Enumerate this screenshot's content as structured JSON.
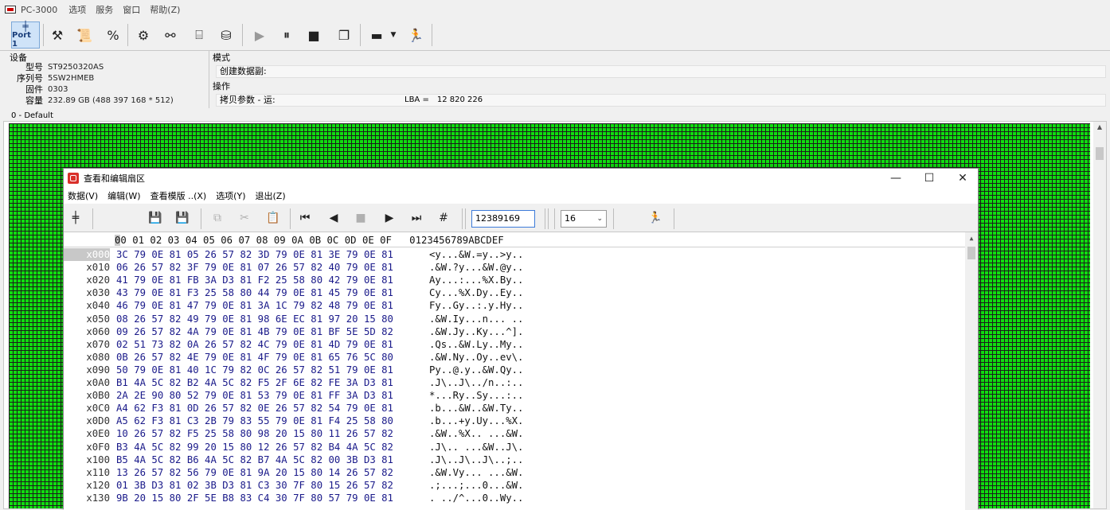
{
  "app": {
    "title": "PC-3000",
    "menu": [
      "选项",
      "服务",
      "窗口",
      "帮助(Z)"
    ]
  },
  "toolbar": {
    "port_label": "Port 1"
  },
  "device": {
    "section_title": "设备",
    "fields": [
      {
        "label": "型号",
        "value": "ST9250320AS"
      },
      {
        "label": "序列号",
        "value": "5SW2HMEB"
      },
      {
        "label": "固件",
        "value": "0303"
      },
      {
        "label": "容量",
        "value": "232.89 GB (488 397 168 * 512)"
      }
    ]
  },
  "mode": {
    "title": "模式",
    "field": "创建数据副:"
  },
  "operation": {
    "title": "操作",
    "field": "拷贝参数 - 运:",
    "lba_label": "LBA =",
    "lba_value": "12 820 226"
  },
  "tab": {
    "label": "0 - Default"
  },
  "sector_window": {
    "title": "查看和编辑扇区",
    "menu": [
      "数据(V)",
      "编辑(W)",
      "查看模版 ..(X)",
      "选项(Y)",
      "退出(Z)"
    ],
    "lba_input": "12389169",
    "size_select": "16",
    "hex_header_first": "0",
    "hex_header_rest": "0 01 02 03 04 05 06 07 08 09 0A 0B 0C 0D 0E 0F   0123456789ABCDEF",
    "rows": [
      {
        "addr": "x000",
        "bytes": "3C 79 0E 81 05 26 57 82 3D 79 0E 81 3E 79 0E 81",
        "ascii": "<y...&W.=y..>y.."
      },
      {
        "addr": "x010",
        "bytes": "06 26 57 82 3F 79 0E 81 07 26 57 82 40 79 0E 81",
        "ascii": ".&W.?y...&W.@y.."
      },
      {
        "addr": "x020",
        "bytes": "41 79 0E 81 FB 3A D3 81 F2 25 58 80 42 79 0E 81",
        "ascii": "Ay...:...%X.By.."
      },
      {
        "addr": "x030",
        "bytes": "43 79 0E 81 F3 25 58 80 44 79 0E 81 45 79 0E 81",
        "ascii": "Cy...%X.Dy..Ey.."
      },
      {
        "addr": "x040",
        "bytes": "46 79 0E 81 47 79 0E 81 3A 1C 79 82 48 79 0E 81",
        "ascii": "Fy..Gy..:.y.Hy.."
      },
      {
        "addr": "x050",
        "bytes": "08 26 57 82 49 79 0E 81 98 6E EC 81 97 20 15 80",
        "ascii": ".&W.Iy...n... .."
      },
      {
        "addr": "x060",
        "bytes": "09 26 57 82 4A 79 0E 81 4B 79 0E 81 BF 5E 5D 82",
        "ascii": ".&W.Jy..Ky...^]."
      },
      {
        "addr": "x070",
        "bytes": "02 51 73 82 0A 26 57 82 4C 79 0E 81 4D 79 0E 81",
        "ascii": ".Qs..&W.Ly..My.."
      },
      {
        "addr": "x080",
        "bytes": "0B 26 57 82 4E 79 0E 81 4F 79 0E 81 65 76 5C 80",
        "ascii": ".&W.Ny..Oy..ev\\."
      },
      {
        "addr": "x090",
        "bytes": "50 79 0E 81 40 1C 79 82 0C 26 57 82 51 79 0E 81",
        "ascii": "Py..@.y..&W.Qy.."
      },
      {
        "addr": "x0A0",
        "bytes": "B1 4A 5C 82 B2 4A 5C 82 F5 2F 6E 82 FE 3A D3 81",
        "ascii": ".J\\..J\\../n..:.."
      },
      {
        "addr": "x0B0",
        "bytes": "2A 2E 90 80 52 79 0E 81 53 79 0E 81 FF 3A D3 81",
        "ascii": "*...Ry..Sy...:.."
      },
      {
        "addr": "x0C0",
        "bytes": "A4 62 F3 81 0D 26 57 82 0E 26 57 82 54 79 0E 81",
        "ascii": ".b...&W..&W.Ty.."
      },
      {
        "addr": "x0D0",
        "bytes": "A5 62 F3 81 C3 2B 79 83 55 79 0E 81 F4 25 58 80",
        "ascii": ".b...+y.Uy...%X."
      },
      {
        "addr": "x0E0",
        "bytes": "10 26 57 82 F5 25 58 80 98 20 15 80 11 26 57 82",
        "ascii": ".&W..%X.. ...&W."
      },
      {
        "addr": "x0F0",
        "bytes": "B3 4A 5C 82 99 20 15 80 12 26 57 82 B4 4A 5C 82",
        "ascii": ".J\\.. ...&W..J\\."
      },
      {
        "addr": "x100",
        "bytes": "B5 4A 5C 82 B6 4A 5C 82 B7 4A 5C 82 00 3B D3 81",
        "ascii": ".J\\..J\\..J\\..;.."
      },
      {
        "addr": "x110",
        "bytes": "13 26 57 82 56 79 0E 81 9A 20 15 80 14 26 57 82",
        "ascii": ".&W.Vy... ...&W."
      },
      {
        "addr": "x120",
        "bytes": "01 3B D3 81 02 3B D3 81 C3 30 7F 80 15 26 57 82",
        "ascii": ".;...;...0...&W."
      },
      {
        "addr": "x130",
        "bytes": "9B 20 15 80 2F 5E B8 83 C4 30 7F 80 57 79 0E 81",
        "ascii": ". ../^...0..Wy.."
      }
    ]
  }
}
